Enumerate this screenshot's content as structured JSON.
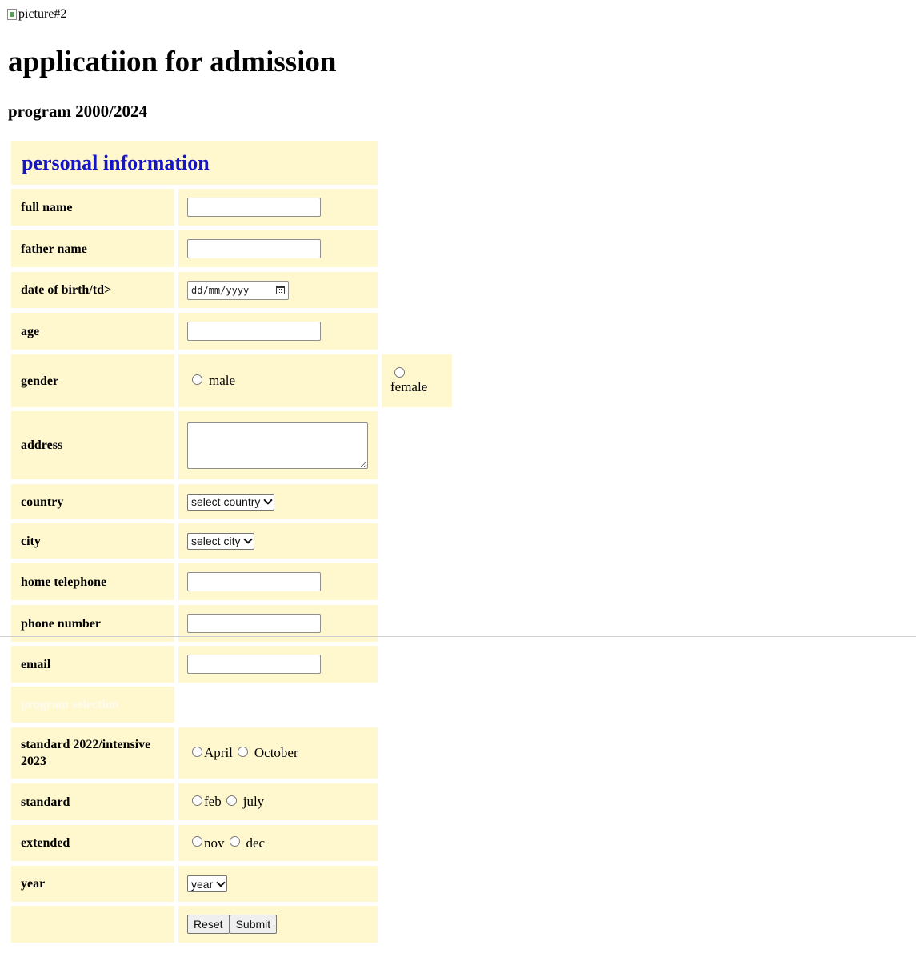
{
  "page": {
    "broken_image_alt": "picture#2",
    "title": "applicatiion for admission",
    "subtitle": "program 2000/2024"
  },
  "personal": {
    "heading": "personal information",
    "full_name_label": "full name",
    "father_name_label": "father name",
    "dob_label": "date of birth/td>",
    "dob_placeholder": "dd/mm/yyyy",
    "age_label": "age",
    "gender_label": "gender",
    "gender_male": "male",
    "gender_female": "female",
    "address_label": "address",
    "country_label": "country",
    "country_selected": "select country",
    "city_label": "city",
    "city_selected": "select city",
    "home_tel_label": "home telephone",
    "phone_label": "phone number",
    "email_label": "email"
  },
  "program": {
    "heading": "program selection",
    "intensive_label": "standard 2022/intensive 2023",
    "intensive_opt1": "April",
    "intensive_opt2": "October",
    "standard_label": "standard",
    "standard_opt1": "feb",
    "standard_opt2": "july",
    "extended_label": "extended",
    "extended_opt1": "nov",
    "extended_opt2": "dec",
    "year_label": "year",
    "year_selected": "year"
  },
  "buttons": {
    "reset": "Reset",
    "submit": "Submit"
  }
}
